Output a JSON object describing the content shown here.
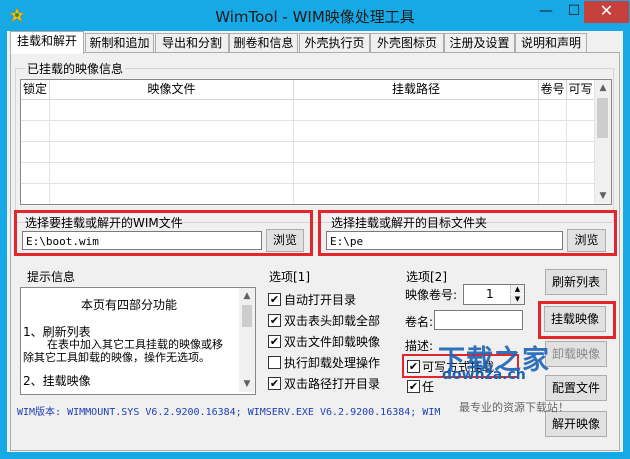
{
  "window": {
    "title": "WimTool - WIM映像处理工具",
    "minimize": "—",
    "maximize": "☐",
    "close": "✕"
  },
  "tabs": [
    "挂载和解开",
    "新制和追加",
    "导出和分割",
    "删卷和信息",
    "外壳执行页",
    "外壳图标页",
    "注册及设置",
    "说明和声明"
  ],
  "mounted": {
    "title": "已挂载的映像信息",
    "columns": [
      "锁定",
      "映像文件",
      "挂载路径",
      "卷号",
      "可写"
    ]
  },
  "wim_file": {
    "label": "选择要挂载或解开的WIM文件",
    "value": "E:\\boot.wim",
    "browse": "浏览"
  },
  "target_dir": {
    "label": "选择挂载或解开的目标文件夹",
    "value": "E:\\pe",
    "browse": "浏览"
  },
  "tips": {
    "title": "提示信息",
    "line1": "本页有四部分功能",
    "line2": "1、刷新列表",
    "line3": "在表中加入其它工具挂载的映像或移",
    "line4": "除其它工具卸载的映像，操作无选项。",
    "line5": "2、挂载映像"
  },
  "options1": {
    "title": "选项[1]",
    "items": [
      {
        "label": "自动打开目录",
        "checked": true
      },
      {
        "label": "双击表头卸载全部",
        "checked": true
      },
      {
        "label": "双击文件卸载映像",
        "checked": true
      },
      {
        "label": "执行卸载处理操作",
        "checked": false
      },
      {
        "label": "双击路径打开目录",
        "checked": true
      }
    ]
  },
  "options2": {
    "title": "选项[2]",
    "index_label": "映像卷号:",
    "index_value": "1",
    "volname_label": "卷名:",
    "desc_label": "描述:",
    "writable_label": "可写方式挂载",
    "task_label": "任"
  },
  "buttons": {
    "refresh": "刷新列表",
    "mount": "挂载映像",
    "unmount": "卸载映像",
    "config": "配置文件",
    "extract": "解开映像"
  },
  "version_text": "WIM版本: WIMMOUNT.SYS V6.2.9200.16384; WIMSERV.EXE V6.2.9200.16384; WIM",
  "watermark": {
    "main": "下载之家",
    "url": "downza.cn",
    "sub": "最专业的资源下载站！"
  }
}
